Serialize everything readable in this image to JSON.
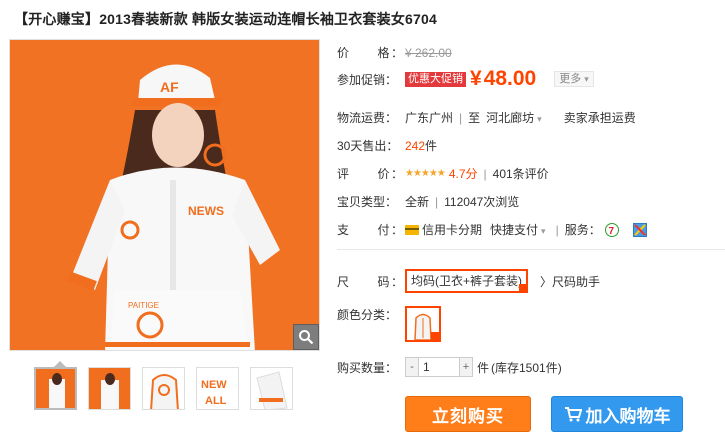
{
  "title": "【开心赚宝】2013春装新款 韩版女装运动连帽长袖卫衣套装女6704",
  "price": {
    "label": "价　　格：",
    "original": "¥ 262.00"
  },
  "promo": {
    "label": "参加促销：",
    "badge": "优惠大促销",
    "currency": "¥",
    "amount": "48.00",
    "more": "更多"
  },
  "shipping": {
    "label": "物流运费：",
    "from": "广东广州",
    "to_word": "至",
    "to": "河北廊坊",
    "carrier_note": "卖家承担运费"
  },
  "sales": {
    "label": "30天售出：",
    "count": "242",
    "unit": "件"
  },
  "rating": {
    "label": "评　　价：",
    "stars": "★★★★★",
    "score": "4.7分",
    "reviews": "401条评价"
  },
  "type": {
    "label": "宝贝类型：",
    "condition": "全新",
    "views": "112047次浏览"
  },
  "payment": {
    "label": "支　　付：",
    "credit": "信用卡分期",
    "quick": "快捷支付",
    "service_label": "服务："
  },
  "size": {
    "label": "尺　　码：",
    "selected": "均码(卫衣+裤子套装)",
    "helper": "尺码助手"
  },
  "color": {
    "label": "颜色分类："
  },
  "quantity": {
    "label": "购买数量：",
    "value": "1",
    "minus": "-",
    "plus": "+",
    "unit": "件",
    "stock": "(库存1501件)"
  },
  "buttons": {
    "buy_now": "立刻购买",
    "add_to_cart": "加入购物车"
  },
  "icons": {
    "zoom": "magnifier-icon",
    "cart": "cart-icon",
    "credit": "credit-card-icon",
    "service_a": "seven-day-return-icon",
    "service_b": "guarantee-icon"
  },
  "colors": {
    "accent": "#ff4400",
    "buy": "#ff7e1a",
    "cart": "#3299ee",
    "bg_photo": "#f06e1e"
  }
}
